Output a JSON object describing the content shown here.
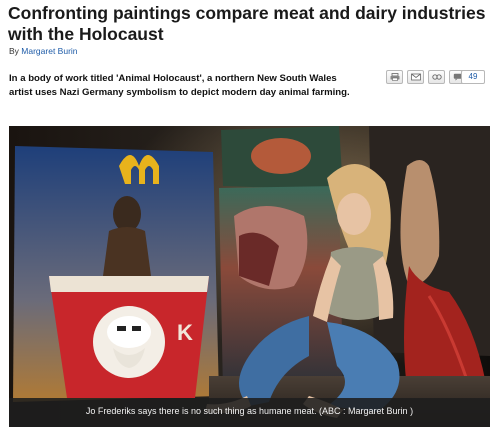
{
  "article": {
    "headline": "Confronting paintings compare meat and dairy industries with the Holocaust",
    "byline_prefix": "By",
    "author": "Margaret Burin",
    "intro": "In a body of work titled 'Animal Holocaust', a northern New South Wales artist uses Nazi Germany symbolism to depict modern day animal farming."
  },
  "tools": {
    "icons": [
      "print-icon",
      "email-icon",
      "share-icon",
      "comment-icon"
    ],
    "comment_count": "49"
  },
  "photo": {
    "caption": "Jo Frederiks says there is no such thing as humane meat. (ABC : Margaret Burin )",
    "bucket_text": "K"
  },
  "colors": {
    "link": "#1f5ca8",
    "caption_bg": "#1e1e1e"
  }
}
